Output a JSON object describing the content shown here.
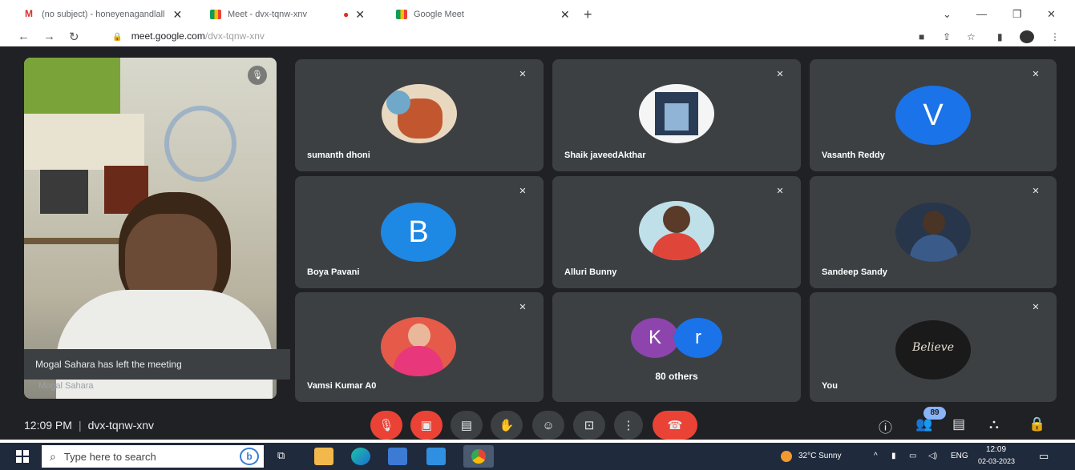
{
  "browser": {
    "tabs": [
      {
        "title": "(no subject) - honeyenagandlall",
        "icon": "gmail-icon"
      },
      {
        "title": "Meet - dvx-tqnw-xnv",
        "icon": "meet-icon"
      },
      {
        "title": "Google Meet",
        "icon": "meet-icon"
      }
    ],
    "url_host": "meet.google.com",
    "url_path": "/dvx-tqnw-xnv"
  },
  "meet": {
    "self_view_name": "Mogal Sahara",
    "toast": "Mogal Sahara has left the meeting",
    "participants": [
      {
        "name": "sumanth dhoni",
        "avatar": "photo",
        "color": "#e9d8c0"
      },
      {
        "name": "Shaik javeedAkthar",
        "avatar": "photo",
        "color": "#cfd9e6"
      },
      {
        "name": "Vasanth Reddy",
        "avatar": "letter",
        "letter": "V",
        "color": "#1a73e8"
      },
      {
        "name": "Boya Pavani",
        "avatar": "letter",
        "letter": "B",
        "color": "#1e88e5"
      },
      {
        "name": "Alluri Bunny",
        "avatar": "photo",
        "color": "#d9634c"
      },
      {
        "name": "Sandeep Sandy",
        "avatar": "photo",
        "color": "#27364a"
      },
      {
        "name": "Vamsi Kumar A0",
        "avatar": "photo",
        "color": "#d23b4f"
      },
      {
        "name": "80 others",
        "avatar": "group",
        "letters": [
          "K",
          "r"
        ],
        "colors": [
          "#8e44ad",
          "#1a73e8"
        ]
      },
      {
        "name": "You",
        "avatar": "photo",
        "color": "#1a1a1a",
        "overlay": "Believe"
      }
    ],
    "time": "12:09 PM",
    "meeting_code": "dvx-tqnw-xnv",
    "people_count": "89",
    "controls": [
      "mic-off-icon",
      "camera-off-icon",
      "captions-icon",
      "raise-hand-icon",
      "emoji-icon",
      "present-icon",
      "more-icon",
      "end-call-icon"
    ],
    "right_controls": [
      "info-icon",
      "people-icon",
      "chat-icon",
      "activities-icon",
      "host-controls-icon"
    ]
  },
  "taskbar": {
    "search_placeholder": "Type here to search",
    "weather": "32°C  Sunny",
    "language": "ENG",
    "clock_time": "12:09",
    "clock_date": "02-03-2023"
  }
}
